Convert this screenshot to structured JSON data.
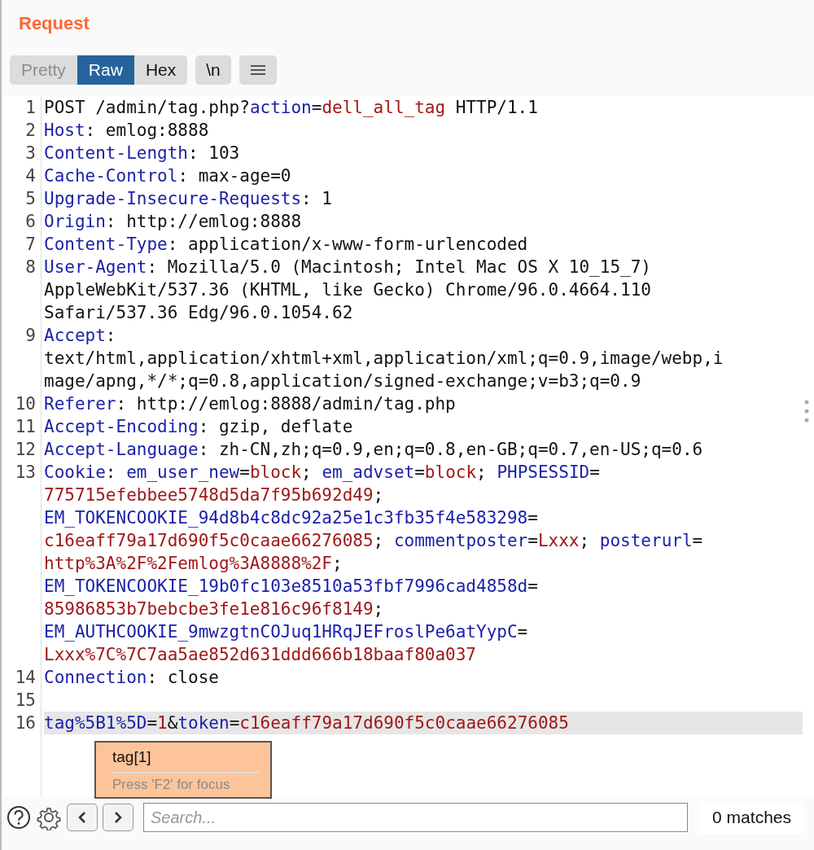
{
  "panel": {
    "title": "Request"
  },
  "view_tabs": [
    {
      "label": "Pretty",
      "selected": false,
      "disabled": true
    },
    {
      "label": "Raw",
      "selected": true,
      "disabled": false
    },
    {
      "label": "Hex",
      "selected": false,
      "disabled": false
    }
  ],
  "newline_button": {
    "label": "\\n"
  },
  "lines": [
    {
      "number": "1",
      "selected": false,
      "rows": [
        {
          "segments": [
            {
              "kind": "plain",
              "text": "POST /admin/tag.php?"
            },
            {
              "kind": "name",
              "text": "action"
            },
            {
              "kind": "plain",
              "text": "="
            },
            {
              "kind": "value",
              "text": "dell_all_tag"
            },
            {
              "kind": "plain",
              "text": " HTTP/1.1"
            }
          ]
        }
      ]
    },
    {
      "number": "2",
      "selected": false,
      "rows": [
        {
          "segments": [
            {
              "kind": "name",
              "text": "Host"
            },
            {
              "kind": "plain",
              "text": ": emlog:8888"
            }
          ]
        }
      ]
    },
    {
      "number": "3",
      "selected": false,
      "rows": [
        {
          "segments": [
            {
              "kind": "name",
              "text": "Content-Length"
            },
            {
              "kind": "plain",
              "text": ": 103"
            }
          ]
        }
      ]
    },
    {
      "number": "4",
      "selected": false,
      "rows": [
        {
          "segments": [
            {
              "kind": "name",
              "text": "Cache-Control"
            },
            {
              "kind": "plain",
              "text": ": max-age=0"
            }
          ]
        }
      ]
    },
    {
      "number": "5",
      "selected": false,
      "rows": [
        {
          "segments": [
            {
              "kind": "name",
              "text": "Upgrade-Insecure-Requests"
            },
            {
              "kind": "plain",
              "text": ": 1"
            }
          ]
        }
      ]
    },
    {
      "number": "6",
      "selected": false,
      "rows": [
        {
          "segments": [
            {
              "kind": "name",
              "text": "Origin"
            },
            {
              "kind": "plain",
              "text": ": http://emlog:8888"
            }
          ]
        }
      ]
    },
    {
      "number": "7",
      "selected": false,
      "rows": [
        {
          "segments": [
            {
              "kind": "name",
              "text": "Content-Type"
            },
            {
              "kind": "plain",
              "text": ": application/x-www-form-urlencoded"
            }
          ]
        }
      ]
    },
    {
      "number": "8",
      "selected": false,
      "rows": [
        {
          "segments": [
            {
              "kind": "name",
              "text": "User-Agent"
            },
            {
              "kind": "plain",
              "text": ": Mozilla/5.0 (Macintosh; Intel Mac OS X 10_15_7)"
            }
          ]
        },
        {
          "segments": [
            {
              "kind": "plain",
              "text": "AppleWebKit/537.36 (KHTML, like Gecko) Chrome/96.0.4664.110"
            }
          ]
        },
        {
          "segments": [
            {
              "kind": "plain",
              "text": "Safari/537.36 Edg/96.0.1054.62"
            }
          ]
        }
      ]
    },
    {
      "number": "9",
      "selected": false,
      "rows": [
        {
          "segments": [
            {
              "kind": "name",
              "text": "Accept"
            },
            {
              "kind": "plain",
              "text": ":"
            }
          ]
        },
        {
          "segments": [
            {
              "kind": "plain",
              "text": "text/html,application/xhtml+xml,application/xml;q=0.9,image/webp,i"
            }
          ]
        },
        {
          "segments": [
            {
              "kind": "plain",
              "text": "mage/apng,*/*;q=0.8,application/signed-exchange;v=b3;q=0.9"
            }
          ]
        }
      ]
    },
    {
      "number": "10",
      "selected": false,
      "rows": [
        {
          "segments": [
            {
              "kind": "name",
              "text": "Referer"
            },
            {
              "kind": "plain",
              "text": ": http://emlog:8888/admin/tag.php"
            }
          ]
        }
      ]
    },
    {
      "number": "11",
      "selected": false,
      "rows": [
        {
          "segments": [
            {
              "kind": "name",
              "text": "Accept-Encoding"
            },
            {
              "kind": "plain",
              "text": ": gzip, deflate"
            }
          ]
        }
      ]
    },
    {
      "number": "12",
      "selected": false,
      "rows": [
        {
          "segments": [
            {
              "kind": "name",
              "text": "Accept-Language"
            },
            {
              "kind": "plain",
              "text": ": zh-CN,zh;q=0.9,en;q=0.8,en-GB;q=0.7,en-US;q=0.6"
            }
          ]
        }
      ]
    },
    {
      "number": "13",
      "selected": false,
      "rows": [
        {
          "segments": [
            {
              "kind": "name",
              "text": "Cookie"
            },
            {
              "kind": "plain",
              "text": ": "
            },
            {
              "kind": "name",
              "text": "em_user_new"
            },
            {
              "kind": "plain",
              "text": "="
            },
            {
              "kind": "value",
              "text": "block"
            },
            {
              "kind": "plain",
              "text": "; "
            },
            {
              "kind": "name",
              "text": "em_advset"
            },
            {
              "kind": "plain",
              "text": "="
            },
            {
              "kind": "value",
              "text": "block"
            },
            {
              "kind": "plain",
              "text": "; "
            },
            {
              "kind": "name",
              "text": "PHPSESSID"
            },
            {
              "kind": "plain",
              "text": "="
            }
          ]
        },
        {
          "segments": [
            {
              "kind": "value",
              "text": "775715efebbee5748d5da7f95b692d49"
            },
            {
              "kind": "plain",
              "text": ";"
            }
          ]
        },
        {
          "segments": [
            {
              "kind": "name",
              "text": "EM_TOKENCOOKIE_94d8b4c8dc92a25e1c3fb35f4e583298"
            },
            {
              "kind": "plain",
              "text": "="
            }
          ]
        },
        {
          "segments": [
            {
              "kind": "value",
              "text": "c16eaff79a17d690f5c0caae66276085"
            },
            {
              "kind": "plain",
              "text": "; "
            },
            {
              "kind": "name",
              "text": "commentposter"
            },
            {
              "kind": "plain",
              "text": "="
            },
            {
              "kind": "value",
              "text": "Lxxx"
            },
            {
              "kind": "plain",
              "text": "; "
            },
            {
              "kind": "name",
              "text": "posterurl"
            },
            {
              "kind": "plain",
              "text": "="
            }
          ]
        },
        {
          "segments": [
            {
              "kind": "value",
              "text": "http%3A%2F%2Femlog%3A8888%2F"
            },
            {
              "kind": "plain",
              "text": ";"
            }
          ]
        },
        {
          "segments": [
            {
              "kind": "name",
              "text": "EM_TOKENCOOKIE_19b0fc103e8510a53fbf7996cad4858d"
            },
            {
              "kind": "plain",
              "text": "="
            }
          ]
        },
        {
          "segments": [
            {
              "kind": "value",
              "text": "85986853b7bebcbe3fe1e816c96f8149"
            },
            {
              "kind": "plain",
              "text": ";"
            }
          ]
        },
        {
          "segments": [
            {
              "kind": "name",
              "text": "EM_AUTHCOOKIE_9mwzgtnCOJuq1HRqJEFroslPe6atYypC"
            },
            {
              "kind": "plain",
              "text": "="
            }
          ]
        },
        {
          "segments": [
            {
              "kind": "value",
              "text": "Lxxx%7C%7C7aa5ae852d631ddd666b18baaf80a037"
            }
          ]
        }
      ]
    },
    {
      "number": "14",
      "selected": false,
      "rows": [
        {
          "segments": [
            {
              "kind": "name",
              "text": "Connection"
            },
            {
              "kind": "plain",
              "text": ": close"
            }
          ]
        }
      ]
    },
    {
      "number": "15",
      "selected": false
    },
    {
      "number": "16",
      "selected": true,
      "rows": [
        {
          "segments": [
            {
              "kind": "name",
              "text": "tag%5B1%5D"
            },
            {
              "kind": "plain",
              "text": "="
            },
            {
              "kind": "value",
              "text": "1"
            },
            {
              "kind": "plain",
              "text": "&"
            },
            {
              "kind": "name",
              "text": "token"
            },
            {
              "kind": "plain",
              "text": "="
            },
            {
              "kind": "value",
              "text": "c16eaff79a17d690f5c0caae66276085"
            }
          ]
        }
      ]
    }
  ],
  "tooltip": {
    "title": "tag[1]",
    "hint": "Press 'F2' for focus"
  },
  "search": {
    "placeholder": "Search...",
    "matches": "0 matches"
  }
}
